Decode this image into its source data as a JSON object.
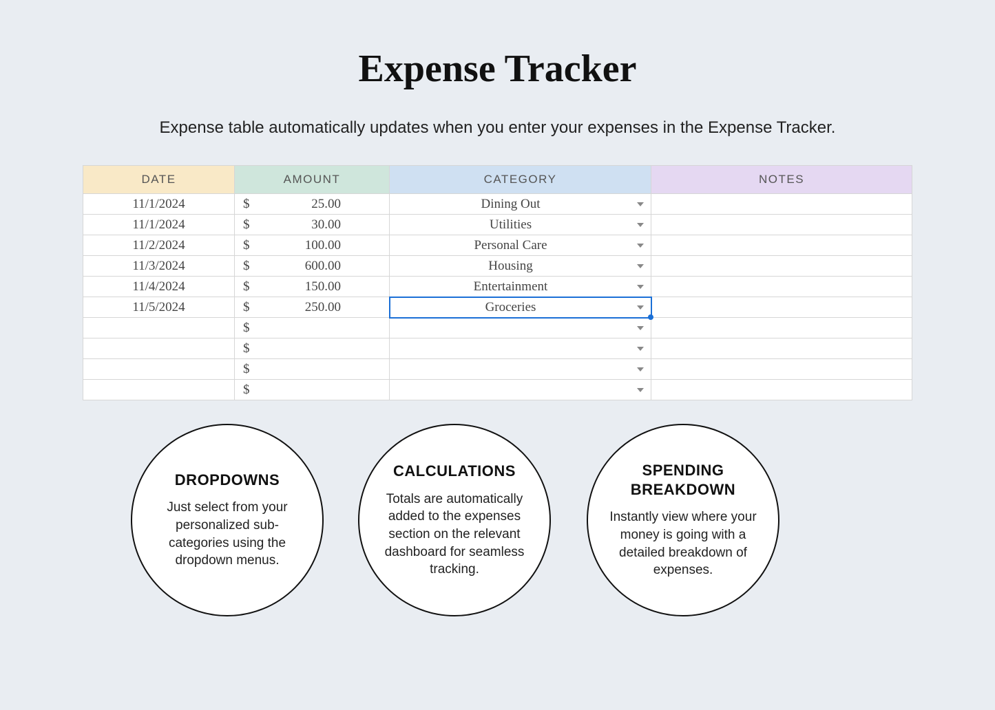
{
  "title": "Expense Tracker",
  "subtitle": "Expense table automatically updates when you enter your expenses in the Expense Tracker.",
  "table": {
    "headers": {
      "date": "DATE",
      "amount": "AMOUNT",
      "category": "CATEGORY",
      "notes": "NOTES"
    },
    "currency_symbol": "$",
    "rows": [
      {
        "date": "11/1/2024",
        "amount": "25.00",
        "category": "Dining Out",
        "notes": "",
        "selected": false
      },
      {
        "date": "11/1/2024",
        "amount": "30.00",
        "category": "Utilities",
        "notes": "",
        "selected": false
      },
      {
        "date": "11/2/2024",
        "amount": "100.00",
        "category": "Personal Care",
        "notes": "",
        "selected": false
      },
      {
        "date": "11/3/2024",
        "amount": "600.00",
        "category": "Housing",
        "notes": "",
        "selected": false
      },
      {
        "date": "11/4/2024",
        "amount": "150.00",
        "category": "Entertainment",
        "notes": "",
        "selected": false
      },
      {
        "date": "11/5/2024",
        "amount": "250.00",
        "category": "Groceries",
        "notes": "",
        "selected": true
      },
      {
        "date": "",
        "amount": "",
        "category": "",
        "notes": "",
        "selected": false
      },
      {
        "date": "",
        "amount": "",
        "category": "",
        "notes": "",
        "selected": false
      },
      {
        "date": "",
        "amount": "",
        "category": "",
        "notes": "",
        "selected": false
      },
      {
        "date": "",
        "amount": "",
        "category": "",
        "notes": "",
        "selected": false
      }
    ]
  },
  "features": [
    {
      "title": "DROPDOWNS",
      "body": "Just select from your personalized sub-categories using the dropdown menus."
    },
    {
      "title": "CALCULATIONS",
      "body": "Totals are automatically added to the expenses section on the relevant dashboard for seamless tracking."
    },
    {
      "title": "SPENDING BREAKDOWN",
      "body": "Instantly view where your money is going with a detailed breakdown of expenses."
    }
  ]
}
